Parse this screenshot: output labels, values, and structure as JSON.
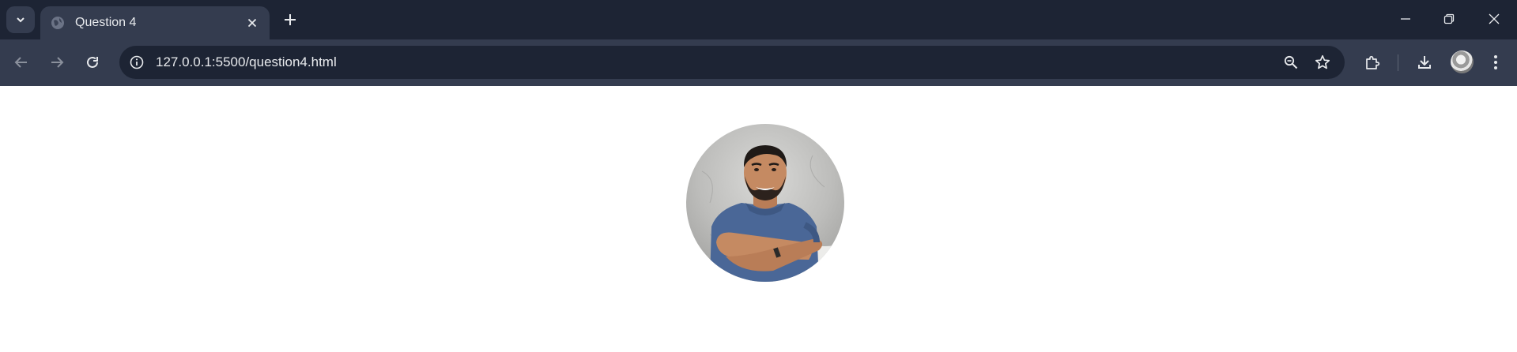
{
  "browser": {
    "tab": {
      "title": "Question 4"
    },
    "address_bar": {
      "url": "127.0.0.1:5500/question4.html"
    }
  },
  "page": {
    "profile_image": {
      "subject": "smiling man with crossed arms in blue t-shirt"
    }
  },
  "colors": {
    "chrome_dark": "#1d2434",
    "chrome_mid": "#343c4f",
    "text": "#e8eaed",
    "shirt": "#4a6797",
    "skin": "#c58a62"
  },
  "icons": [
    "tab-search-icon",
    "globe-icon",
    "close-icon",
    "plus-icon",
    "minimize-icon",
    "restore-icon",
    "back-icon",
    "forward-icon",
    "reload-icon",
    "info-icon",
    "zoom-icon",
    "star-icon",
    "extensions-icon",
    "download-icon",
    "menu-icon"
  ]
}
